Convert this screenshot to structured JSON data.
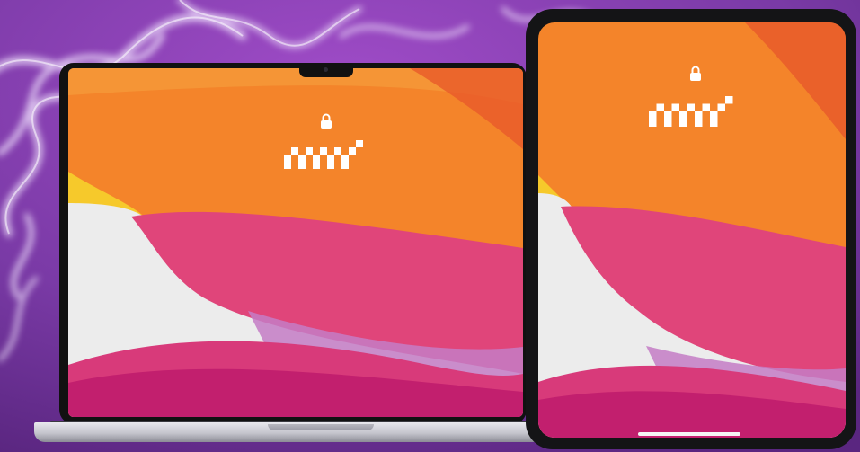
{
  "colors": {
    "background_purple": "#6a2c91",
    "wallpaper_orange": "#f4842a",
    "wallpaper_magenta": "#e0457a",
    "wallpaper_pink_bottom": "#c21f6e",
    "wallpaper_light": "#ececec",
    "wallpaper_lavender": "#c47cc6",
    "wallpaper_yellow": "#f6c92b"
  },
  "laptop": {
    "lock_icon": "lock-icon",
    "time_display_pixel_rows": [
      "101010101010",
      "010101010101"
    ]
  },
  "tablet": {
    "lock_icon": "lock-icon",
    "time_display_pixel_rows": [
      "101010101010",
      "010101010101"
    ],
    "status_left": "",
    "status_right": ""
  }
}
